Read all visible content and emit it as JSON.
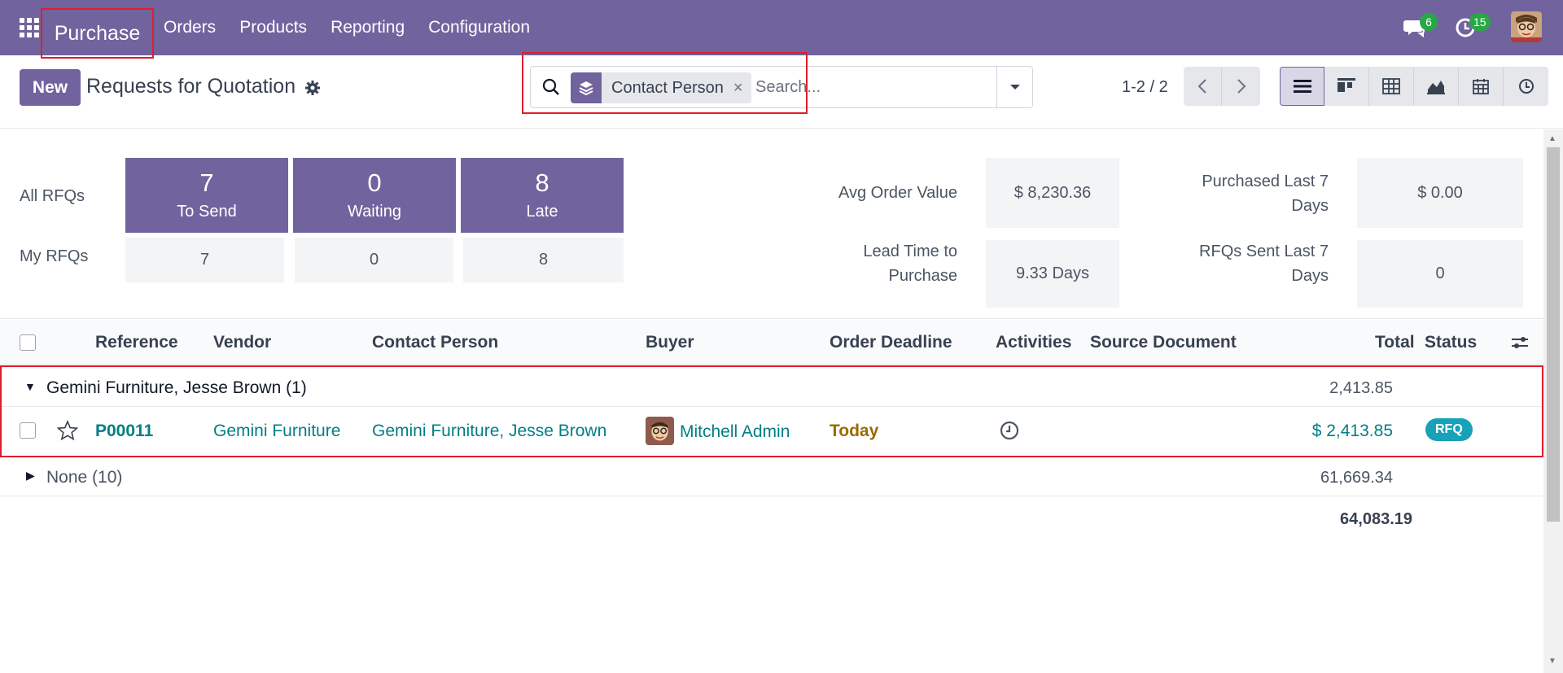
{
  "nav": {
    "brand": "Purchase",
    "menu": [
      "Orders",
      "Products",
      "Reporting",
      "Configuration"
    ],
    "chat_count": "6",
    "activity_count": "15"
  },
  "control": {
    "new_label": "New",
    "title": "Requests for Quotation",
    "facet_label": "Contact Person",
    "facet_close": "×",
    "search_placeholder": "Search...",
    "pager": "1-2 / 2"
  },
  "dashboard": {
    "all_rfqs": "All RFQs",
    "my_rfqs": "My RFQs",
    "tiles": [
      {
        "num": "7",
        "caption": "To Send"
      },
      {
        "num": "0",
        "caption": "Waiting"
      },
      {
        "num": "8",
        "caption": "Late"
      }
    ],
    "my_values": [
      "7",
      "0",
      "8"
    ],
    "stats": [
      {
        "label": "Avg Order Value",
        "value": "$ 8,230.36"
      },
      {
        "label": "Lead Time to Purchase",
        "value": "9.33 Days"
      },
      {
        "label": "Purchased Last 7 Days",
        "value": "$ 0.00"
      },
      {
        "label": "RFQs Sent Last 7 Days",
        "value": "0"
      }
    ]
  },
  "table": {
    "columns": [
      "Reference",
      "Vendor",
      "Contact Person",
      "Buyer",
      "Order Deadline",
      "Activities",
      "Source Document",
      "Total",
      "Status"
    ],
    "groups": [
      {
        "name": "Gemini Furniture, Jesse Brown (1)",
        "total": "2,413.85",
        "expanded": true
      },
      {
        "name": "None (10)",
        "total": "61,669.34",
        "expanded": false
      }
    ],
    "rows": [
      {
        "reference": "P00011",
        "vendor": "Gemini Furniture",
        "contact": "Gemini Furniture, Jesse Brown",
        "buyer": "Mitchell Admin",
        "deadline": "Today",
        "total": "$ 2,413.85",
        "status": "RFQ"
      }
    ],
    "grand_total": "64,083.19"
  },
  "colors": {
    "brand": "#71639e",
    "link": "#017e84",
    "deadline": "#9a6b00",
    "status_badge": "#17a2b8",
    "highlight": "#e11d2b"
  }
}
